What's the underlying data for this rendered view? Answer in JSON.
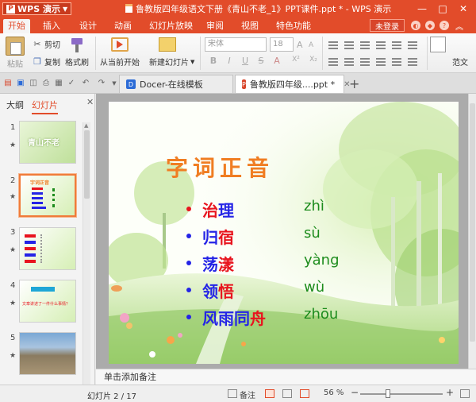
{
  "titlebar": {
    "app_menu": "WPS 演示",
    "title": "鲁教版四年级语文下册《青山不老_1》PPT课件.ppt * - WPS 演示",
    "minimize": "—",
    "maximize": "□",
    "close": "✕"
  },
  "ribbon_tabs": [
    "开始",
    "插入",
    "设计",
    "动画",
    "幻灯片放映",
    "审阅",
    "视图",
    "特色功能"
  ],
  "login_button": "未登录",
  "toolbar": {
    "paste": "粘贴",
    "cut": "剪切",
    "copy": "复制",
    "format_painter": "格式刷",
    "from_current": "从当前开始",
    "new_slide": "新建幻灯片",
    "font_name": "宋体",
    "font_size": "18",
    "bold": "B",
    "italic": "I",
    "underline": "U",
    "strike": "S",
    "superscript": "X²",
    "subscript": "X₂",
    "shrink_font": "A",
    "grow_font": "A",
    "clear_format": "A",
    "font_color": "A",
    "text_box": "范文"
  },
  "doc_tabs": [
    {
      "label": "Docer-在线模板",
      "icon_color": "#2c6bd6"
    },
    {
      "label": "鲁教版四年级....ppt *",
      "icon_color": "#d8452a"
    }
  ],
  "new_tab": "+",
  "left_panel": {
    "tab_outline": "大纲",
    "tab_slides": "幻灯片",
    "close": "✕",
    "thumbnails": [
      {
        "num": "1",
        "text": "青山不老"
      },
      {
        "num": "2",
        "text": "字词正音"
      },
      {
        "num": "3",
        "text": ""
      },
      {
        "num": "4",
        "text": "文章讲述了一件什么事情？"
      },
      {
        "num": "5",
        "text": ""
      }
    ],
    "star": "★"
  },
  "slide": {
    "title": "字词正音",
    "rows": [
      {
        "parts": [
          {
            "t": "治",
            "c": "#e8141e"
          },
          {
            "t": "理",
            "c": "#2424e6"
          }
        ],
        "pinyin": "zhì",
        "bullet": "#e8141e"
      },
      {
        "parts": [
          {
            "t": "归",
            "c": "#2424e6"
          },
          {
            "t": "宿",
            "c": "#e8141e"
          }
        ],
        "pinyin": "sù",
        "bullet": "#2424e6"
      },
      {
        "parts": [
          {
            "t": "荡",
            "c": "#2424e6"
          },
          {
            "t": "漾",
            "c": "#e8141e"
          }
        ],
        "pinyin": "yàng",
        "bullet": "#2424e6"
      },
      {
        "parts": [
          {
            "t": "领",
            "c": "#2424e6"
          },
          {
            "t": "悟",
            "c": "#e8141e"
          }
        ],
        "pinyin": "wù",
        "bullet": "#2424e6"
      },
      {
        "parts": [
          {
            "t": "风雨同",
            "c": "#2424e6"
          },
          {
            "t": "舟",
            "c": "#e8141e"
          }
        ],
        "pinyin": "zhōu",
        "bullet": "#2424e6"
      }
    ]
  },
  "notes_placeholder": "单击添加备注",
  "status": {
    "slide_counter": "幻灯片 2 / 17",
    "notes_label": "备注",
    "zoom": "56 %",
    "zoom_level": 0.56,
    "zoom_minus": "−",
    "zoom_plus": "+"
  },
  "colors": {
    "accent": "#e24c2a",
    "title_orange": "#f07d22",
    "pinyin_green": "#1d8c1d"
  }
}
